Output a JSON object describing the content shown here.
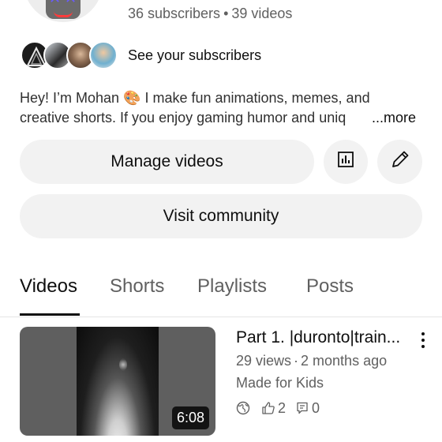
{
  "channel": {
    "subscribers": "36 subscribers",
    "separator": "•",
    "videos": "39 videos",
    "see_subscribers_label": "See your subscribers",
    "bio_line1": "Hey! I’m Mohan 🎨 I make fun animations, memes, and",
    "bio_line2": "creative shorts. If you enjoy gaming humor and uniq",
    "bio_more": "...more"
  },
  "actions": {
    "manage_videos_label": "Manage videos",
    "analytics_icon": "analytics-icon",
    "edit_icon": "pencil-icon",
    "visit_community_label": "Visit community"
  },
  "tabs": [
    {
      "label": "Videos",
      "active": true
    },
    {
      "label": "Shorts",
      "active": false
    },
    {
      "label": "Playlists",
      "active": false
    },
    {
      "label": "Posts",
      "active": false
    }
  ],
  "videos": [
    {
      "title": "Part 1. |duronto|train...",
      "views": "29 views",
      "separator": "·",
      "age": "2 months ago",
      "audience": "Made for Kids",
      "duration": "6:08",
      "likes": "2",
      "comments": "0",
      "visibility_icon": "globe-icon"
    }
  ],
  "colors": {
    "pill_background": "#f2f2f2",
    "secondary_text": "#606060",
    "primary_text": "#0f0f0f"
  }
}
